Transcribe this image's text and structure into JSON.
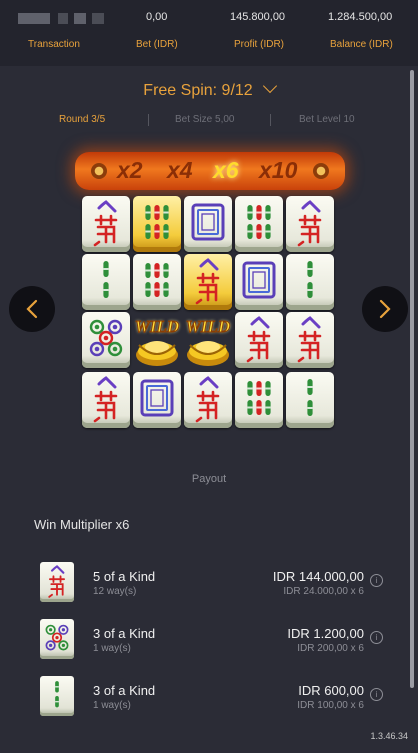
{
  "header": {
    "transaction_label": "Transaction",
    "bet_label": "Bet (IDR)",
    "bet_value": "0,00",
    "profit_label": "Profit (IDR)",
    "profit_value": "145.800,00",
    "balance_label": "Balance (IDR)",
    "balance_value": "1.284.500,00"
  },
  "spin": {
    "title": "Free Spin: 9/12",
    "round": "Round 3/5",
    "bet_size": "Bet Size 5,00",
    "bet_level": "Bet Level 10"
  },
  "multipliers": [
    "x2",
    "x4",
    "x6",
    "x10"
  ],
  "active_multiplier": "x6",
  "reels": [
    [
      "wan",
      "bamboo6",
      "board",
      "bamboo6",
      "wan"
    ],
    [
      "bamboo4",
      "bamboo6",
      "wan",
      "board",
      "bamboo4"
    ],
    [
      "dots5",
      "wild",
      "wild",
      "wan",
      "wan"
    ],
    [
      "wan",
      "board",
      "wan",
      "bamboo6",
      "bamboo4"
    ]
  ],
  "golden_tiles": [
    "row1-col2"
  ],
  "wild_text": "WILD",
  "payout": {
    "title": "Payout",
    "win_multiplier": "Win Multiplier x6",
    "rows": [
      {
        "icon": "wan",
        "kind": "5 of a Kind",
        "ways": "12 way(s)",
        "amount": "IDR 144.000,00",
        "calc": "IDR 24.000,00 x 6"
      },
      {
        "icon": "dots5",
        "kind": "3 of a Kind",
        "ways": "1 way(s)",
        "amount": "IDR 1.200,00",
        "calc": "IDR 200,00 x 6"
      },
      {
        "icon": "bamboo2",
        "kind": "3 of a Kind",
        "ways": "1 way(s)",
        "amount": "IDR 600,00",
        "calc": "IDR 100,00 x 6"
      }
    ]
  },
  "info_glyph": "i",
  "version": "1.3.46.34",
  "colors": {
    "accent": "#e8a23c",
    "background": "#2b2c36",
    "header": "#23242d"
  }
}
